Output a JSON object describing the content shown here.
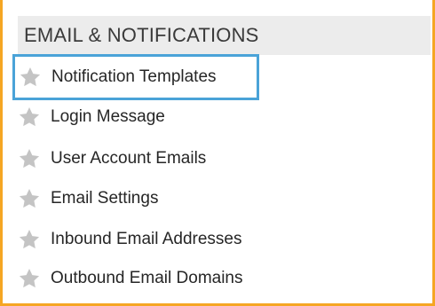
{
  "section": {
    "title": "EMAIL & NOTIFICATIONS"
  },
  "items": [
    {
      "label": "Notification Templates",
      "icon": "star-icon",
      "selected": true
    },
    {
      "label": "Login Message",
      "icon": "star-icon",
      "selected": false
    },
    {
      "label": "User Account Emails",
      "icon": "star-icon",
      "selected": false
    },
    {
      "label": "Email Settings",
      "icon": "star-icon",
      "selected": false
    },
    {
      "label": "Inbound Email Addresses",
      "icon": "star-icon",
      "selected": false
    },
    {
      "label": "Outbound Email Domains",
      "icon": "star-icon",
      "selected": false
    }
  ],
  "colors": {
    "frame_border": "#f5a623",
    "selection_border": "#4aa3d8",
    "header_background": "#ececec",
    "star": "#c4c4c4"
  }
}
